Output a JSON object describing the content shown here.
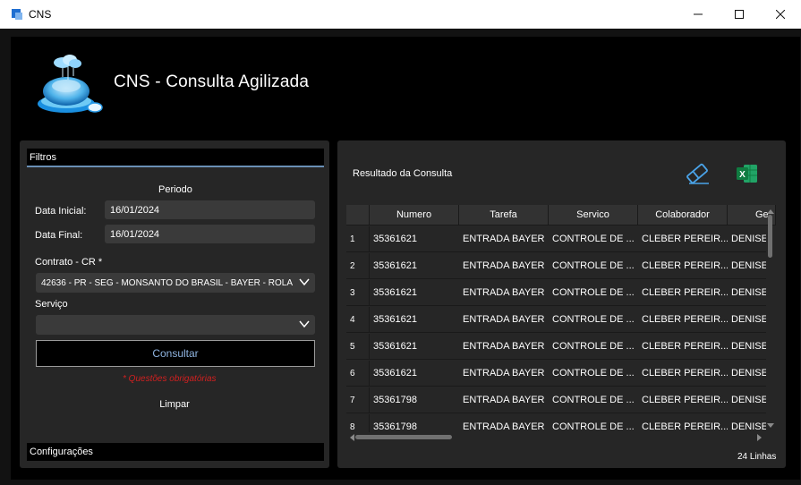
{
  "window": {
    "title": "CNS",
    "controls": [
      "minimize",
      "maximize",
      "close"
    ]
  },
  "header": {
    "title": "CNS - Consulta Agilizada"
  },
  "filters": {
    "section_label": "Filtros",
    "periodo_label": "Periodo",
    "data_inicial_label": "Data Inicial:",
    "data_inicial_value": "16/01/2024",
    "data_final_label": "Data Final:",
    "data_final_value": "16/01/2024",
    "contrato_label": "Contrato - CR *",
    "contrato_value": "42636 - PR - SEG - MONSANTO DO BRASIL - BAYER - ROLA",
    "servico_label": "Serviço",
    "servico_value": "",
    "consultar_label": "Consultar",
    "required_note": "*   Questões obrigatórias",
    "limpar_label": "Limpar",
    "config_label": "Configurações"
  },
  "results": {
    "title": "Resultado da Consulta",
    "icons": {
      "clear": "eraser-icon",
      "export": "excel-icon"
    },
    "columns": [
      "Numero",
      "Tarefa",
      "Servico",
      "Colaborador",
      "Ge"
    ],
    "rows": [
      {
        "n": "1",
        "numero": "35361621",
        "tarefa": "ENTRADA BAYER",
        "servico": "CONTROLE DE ...",
        "colaborador": "CLEBER PEREIR...",
        "ge": "DENISE"
      },
      {
        "n": "2",
        "numero": "35361621",
        "tarefa": "ENTRADA BAYER",
        "servico": "CONTROLE DE ...",
        "colaborador": "CLEBER PEREIR...",
        "ge": "DENISE"
      },
      {
        "n": "3",
        "numero": "35361621",
        "tarefa": "ENTRADA BAYER",
        "servico": "CONTROLE DE ...",
        "colaborador": "CLEBER PEREIR...",
        "ge": "DENISE"
      },
      {
        "n": "4",
        "numero": "35361621",
        "tarefa": "ENTRADA BAYER",
        "servico": "CONTROLE DE ...",
        "colaborador": "CLEBER PEREIR...",
        "ge": "DENISE"
      },
      {
        "n": "5",
        "numero": "35361621",
        "tarefa": "ENTRADA BAYER",
        "servico": "CONTROLE DE ...",
        "colaborador": "CLEBER PEREIR...",
        "ge": "DENISE"
      },
      {
        "n": "6",
        "numero": "35361621",
        "tarefa": "ENTRADA BAYER",
        "servico": "CONTROLE DE ...",
        "colaborador": "CLEBER PEREIR...",
        "ge": "DENISE"
      },
      {
        "n": "7",
        "numero": "35361798",
        "tarefa": "ENTRADA BAYER",
        "servico": "CONTROLE DE ...",
        "colaborador": "CLEBER PEREIR...",
        "ge": "DENISE"
      },
      {
        "n": "8",
        "numero": "35361798",
        "tarefa": "ENTRADA BAYER",
        "servico": "CONTROLE DE ...",
        "colaborador": "CLEBER PEREIR...",
        "ge": "DENISE"
      }
    ],
    "line_count": "24 Linhas"
  },
  "colors": {
    "accent": "#6a8fb5",
    "required": "#d02020",
    "panel": "#262626",
    "background": "#000000"
  }
}
